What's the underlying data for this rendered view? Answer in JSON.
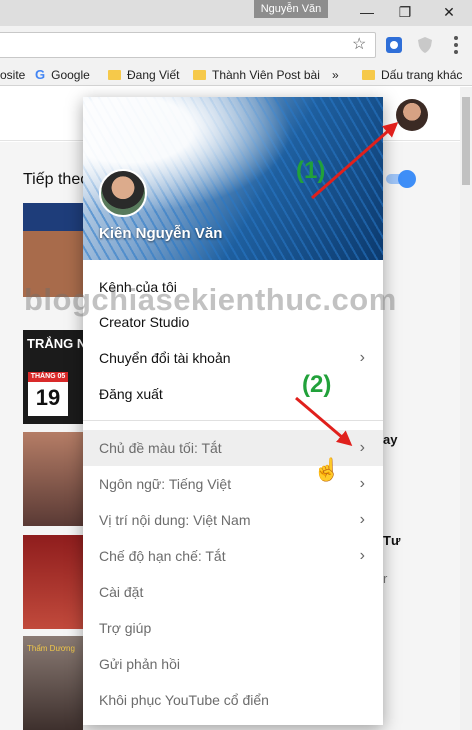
{
  "titlebar": {
    "user": "Nguyễn Văn"
  },
  "toolbar": {
    "star_icon": "star-icon",
    "extensions": [
      "extension-icon-1",
      "shield-icon"
    ]
  },
  "bookmarks": [
    {
      "label": "osite",
      "icon": "none"
    },
    {
      "label": "Google",
      "icon": "google-icon"
    },
    {
      "label": "Đang Viết",
      "icon": "folder-icon"
    },
    {
      "label": "Thành Viên Post bài",
      "icon": "folder-icon"
    },
    {
      "label": "»",
      "icon": "none"
    },
    {
      "label": "Dấu trang khác",
      "icon": "folder-icon"
    }
  ],
  "page": {
    "up_next": "Tiếp theo",
    "autoplay_on": true,
    "thumb2_title": "TRẮNG NE",
    "thumb2_month": "THÁNG 05",
    "thumb2_day": "19",
    "thumb5_text": "Thẩm Dương",
    "side_fragments": [
      "ay",
      "Tư",
      "r"
    ]
  },
  "account": {
    "name": "Kiên Nguyễn Văn"
  },
  "annotations": {
    "step1": "(1)",
    "step2": "(2)",
    "arrow_color": "#e0201c",
    "label_color": "#21a13a"
  },
  "menu": {
    "group1": [
      {
        "label": "Kênh của tôi",
        "chevron": false
      },
      {
        "label": "Creator Studio",
        "chevron": false
      },
      {
        "label": "Chuyển đổi tài khoản",
        "chevron": true
      },
      {
        "label": "Đăng xuất",
        "chevron": false
      }
    ],
    "group2": [
      {
        "label": "Chủ đề màu tối: Tắt",
        "chevron": true
      },
      {
        "label": "Ngôn ngữ: Tiếng Việt",
        "chevron": true
      },
      {
        "label": "Vị trí nội dung: Việt Nam",
        "chevron": true
      },
      {
        "label": "Chế độ hạn chế: Tắt",
        "chevron": true
      },
      {
        "label": "Cài đặt",
        "chevron": false
      },
      {
        "label": "Trợ giúp",
        "chevron": false
      },
      {
        "label": "Gửi phản hồi",
        "chevron": false
      },
      {
        "label": "Khôi phục YouTube cổ điển",
        "chevron": false
      }
    ]
  },
  "watermark": "blogchiasekienthuc.com"
}
